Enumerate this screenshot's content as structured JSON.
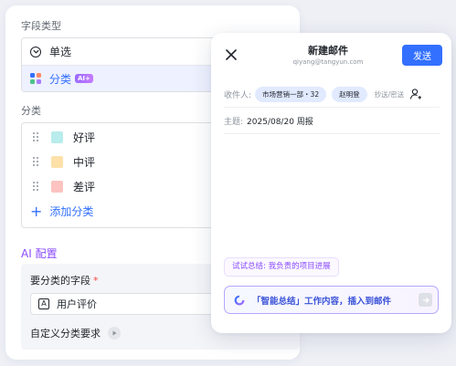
{
  "config": {
    "field_type_label": "字段类型",
    "type_options": [
      {
        "label": "单选",
        "icon": "radio-icon"
      },
      {
        "label": "分类",
        "icon": "grid-icon",
        "badge": "AI+"
      }
    ],
    "category_label": "分类",
    "categories": [
      {
        "label": "好评",
        "color": "#b9ecec"
      },
      {
        "label": "中评",
        "color": "#fde1a9"
      },
      {
        "label": "差评",
        "color": "#fcc3c0"
      }
    ],
    "add_category": "添加分类",
    "ai_config_title": "AI 配置",
    "classify_field_label": "要分类的字段",
    "required_mark": "*",
    "field_value": "用户评价",
    "field_icon_text": "A",
    "custom_requirement": "自定义分类要求"
  },
  "email": {
    "title": "新建邮件",
    "sender": "qiyang@tangyun.com",
    "send_label": "发送",
    "recipient_label": "收件人:",
    "recipients": [
      "市场营销一部・32",
      "赵明登"
    ],
    "cc_label": "抄送/密送",
    "subject_label": "主题:",
    "subject_value": "2025/08/20 周报",
    "suggestion": "试试总结: 我负责的项目进展",
    "ai_prompt": "「智能总结」工作内容，插入到邮件"
  },
  "colors": {
    "accent": "#3370ff",
    "ai_purple": "#8a4bff"
  }
}
